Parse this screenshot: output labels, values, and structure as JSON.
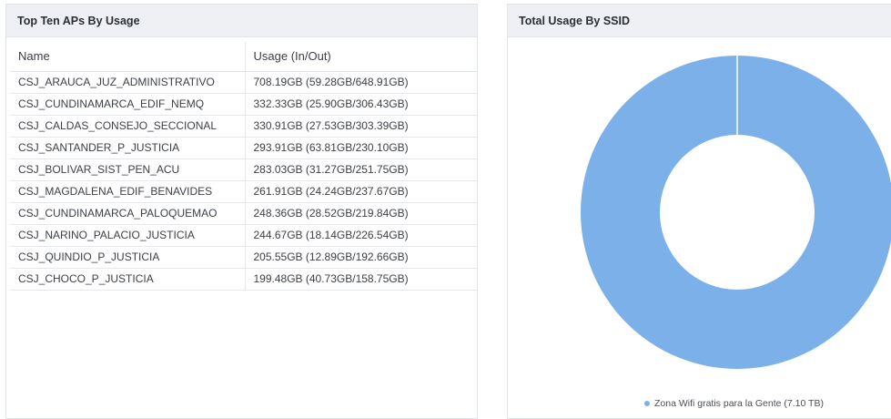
{
  "top_aps": {
    "title": "Top Ten APs By Usage",
    "columns": [
      "Name",
      "Usage (In/Out)"
    ],
    "rows": [
      {
        "name": "CSJ_ARAUCA_JUZ_ADMINISTRATIVO",
        "usage": "708.19GB (59.28GB/648.91GB)"
      },
      {
        "name": "CSJ_CUNDINAMARCA_EDIF_NEMQ",
        "usage": "332.33GB (25.90GB/306.43GB)"
      },
      {
        "name": "CSJ_CALDAS_CONSEJO_SECCIONAL",
        "usage": "330.91GB (27.53GB/303.39GB)"
      },
      {
        "name": "CSJ_SANTANDER_P_JUSTICIA",
        "usage": "293.91GB (63.81GB/230.10GB)"
      },
      {
        "name": "CSJ_BOLIVAR_SIST_PEN_ACU",
        "usage": "283.03GB (31.27GB/251.75GB)"
      },
      {
        "name": "CSJ_MAGDALENA_EDIF_BENAVIDES",
        "usage": "261.91GB (24.24GB/237.67GB)"
      },
      {
        "name": "CSJ_CUNDINAMARCA_PALOQUEMAO",
        "usage": "248.36GB (28.52GB/219.84GB)"
      },
      {
        "name": "CSJ_NARINO_PALACIO_JUSTICIA",
        "usage": "244.67GB (18.14GB/226.54GB)"
      },
      {
        "name": "CSJ_QUINDIO_P_JUSTICIA",
        "usage": "205.55GB (12.89GB/192.66GB)"
      },
      {
        "name": "CSJ_CHOCO_P_JUSTICIA",
        "usage": "199.48GB (40.73GB/158.75GB)"
      }
    ]
  },
  "ssid_usage": {
    "title": "Total Usage By SSID",
    "legend_label": "Zona Wifi gratis para la Gente (7.10 TB)",
    "slice_color": "#7bb1e8"
  },
  "chart_data": {
    "type": "pie",
    "title": "Total Usage By SSID",
    "categories": [
      "Zona Wifi gratis para la Gente"
    ],
    "values": [
      7.1
    ],
    "unit": "TB",
    "legend": "bottom"
  }
}
